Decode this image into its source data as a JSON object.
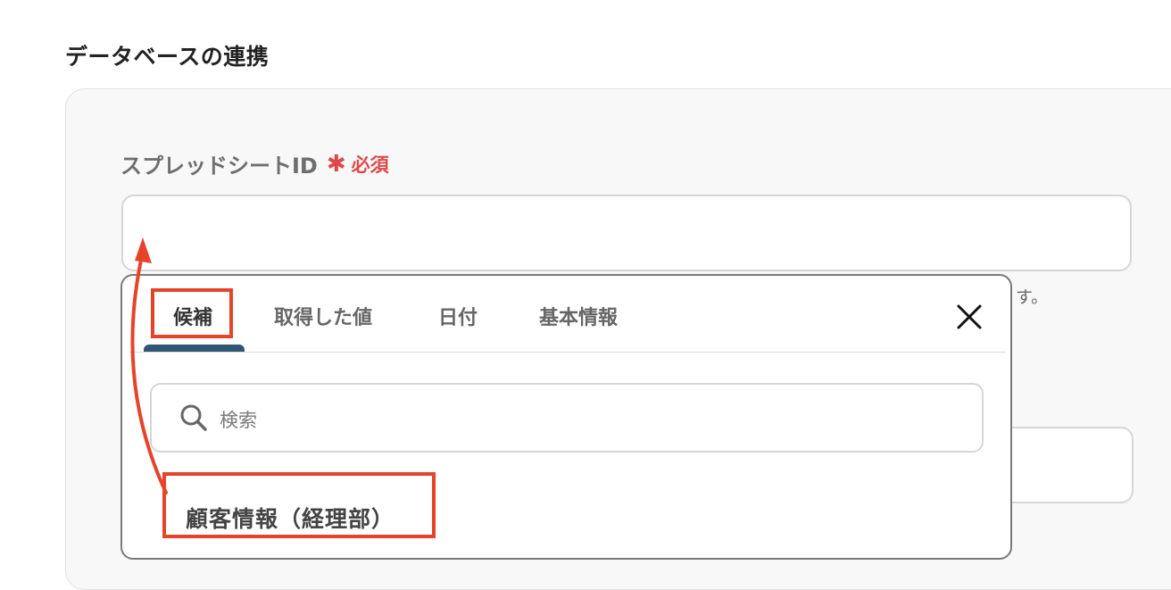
{
  "section": {
    "title": "データベースの連携"
  },
  "field": {
    "label": "スプレッドシートID",
    "required_mark": "✱",
    "required_text": "必須",
    "help_suffix": "す。"
  },
  "dropdown": {
    "tabs": [
      {
        "label": "候補",
        "active": true
      },
      {
        "label": "取得した値",
        "active": false
      },
      {
        "label": "日付",
        "active": false
      },
      {
        "label": "基本情報",
        "active": false
      }
    ],
    "close_icon": "close-icon",
    "search": {
      "placeholder": "検索",
      "icon": "search-icon"
    },
    "items": [
      {
        "label": "顧客情報（経理部）"
      }
    ]
  },
  "annotation": {
    "color": "#e5442a"
  },
  "colors": {
    "accent_tab": "#2f5773",
    "required": "#e04848"
  }
}
